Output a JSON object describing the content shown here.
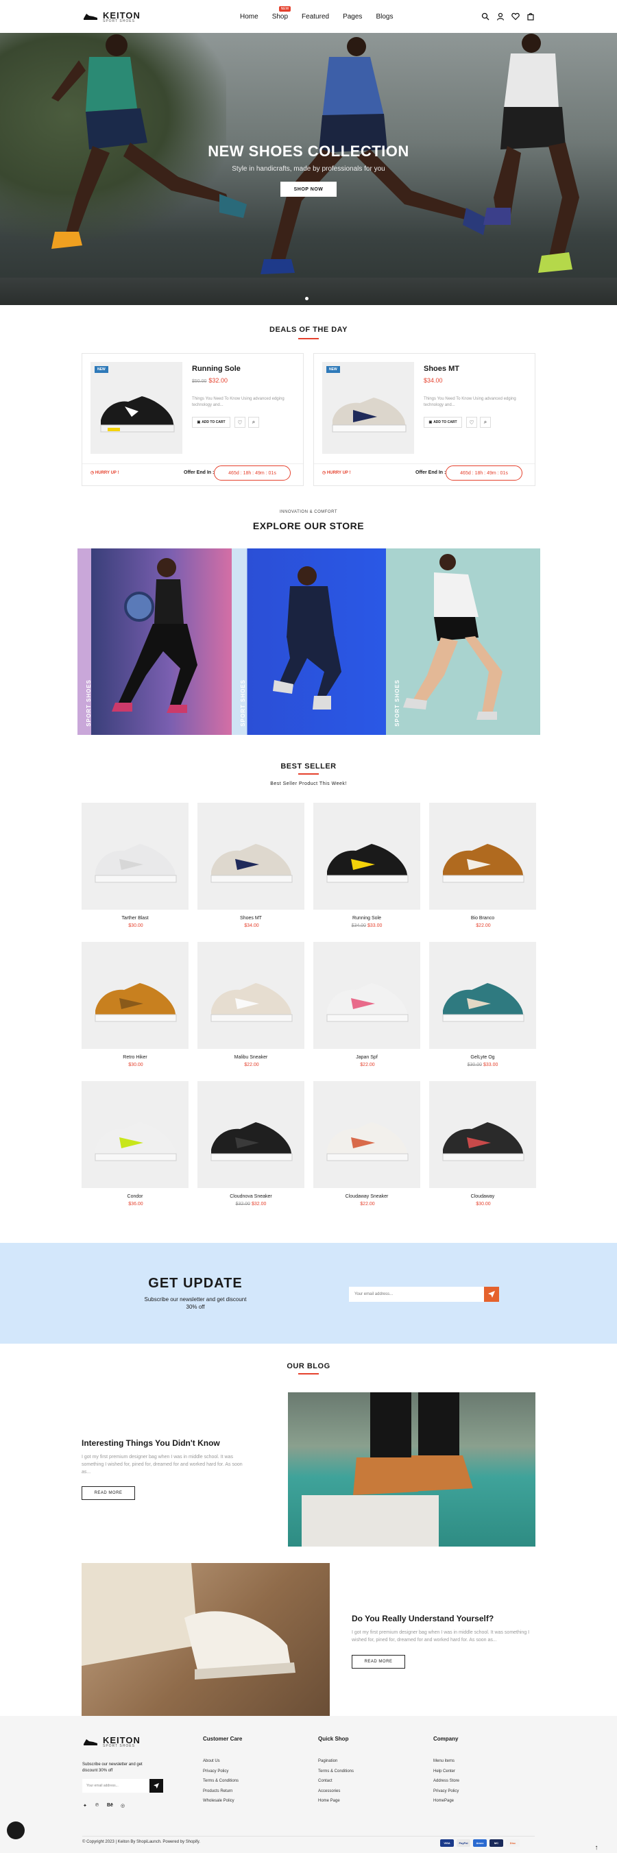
{
  "header": {
    "logo_text": "KEITON",
    "logo_sub": "SPORT SHOES",
    "nav": [
      {
        "label": "Home"
      },
      {
        "label": "Shop",
        "badge": "NEW"
      },
      {
        "label": "Featured"
      },
      {
        "label": "Pages"
      },
      {
        "label": "Blogs"
      }
    ]
  },
  "hero": {
    "title": "NEW SHOES COLLECTION",
    "subtitle": "Style in handicrafts, made by professionals for you",
    "button": "SHOP NOW"
  },
  "deals": {
    "title": "DEALS OF THE DAY",
    "items": [
      {
        "badge": "NEW",
        "name": "Running Sole",
        "old_price": "$50.00",
        "price": "$32.00",
        "desc": "Things You Need To Know Using advanced edging technology and...",
        "cart": "ADD TO CART",
        "hurry": "HURRY UP !",
        "offer": "Offer End In :",
        "timer": "465d : 18h : 49m : 01s"
      },
      {
        "badge": "NEW",
        "name": "Shoes MT",
        "old_price": "",
        "price": "$34.00",
        "desc": "Things You Need To Know Using advanced edging technology and...",
        "cart": "ADD TO CART",
        "hurry": "HURRY UP !",
        "offer": "Offer End In :",
        "timer": "465d : 18h : 49m : 01s"
      }
    ]
  },
  "explore": {
    "kicker": "INNOVATION & COMFORT",
    "title": "EXPLORE OUR STORE",
    "panels": [
      {
        "label": "SPORT SHOES"
      },
      {
        "label": "SPORT SHOES"
      },
      {
        "label": "SPORT SHOES"
      }
    ]
  },
  "bestseller": {
    "title": "BEST SELLER",
    "subtitle": "Best Seller Product This Week!",
    "products": [
      {
        "name": "Tarther Blast",
        "old_price": "",
        "price": "$30.00"
      },
      {
        "name": "Shoes MT",
        "old_price": "",
        "price": "$34.00"
      },
      {
        "name": "Running Sole",
        "old_price": "$34.00",
        "price": "$33.00"
      },
      {
        "name": "Bio Branco",
        "old_price": "",
        "price": "$22.00"
      },
      {
        "name": "Retro Hiker",
        "old_price": "",
        "price": "$30.00"
      },
      {
        "name": "Malibu Sneaker",
        "old_price": "",
        "price": "$22.00"
      },
      {
        "name": "Japan Spf",
        "old_price": "",
        "price": "$22.00"
      },
      {
        "name": "GelLyte Og",
        "old_price": "$30.00",
        "price": "$33.00"
      },
      {
        "name": "Condor",
        "old_price": "",
        "price": "$36.00"
      },
      {
        "name": "Cloudnova Sneaker",
        "old_price": "$32.00",
        "price": "$32.00"
      },
      {
        "name": "Cloudaway Sneaker",
        "old_price": "",
        "price": "$22.00"
      },
      {
        "name": "Cloudaway",
        "old_price": "",
        "price": "$30.00"
      }
    ]
  },
  "newsletter": {
    "title": "GET UPDATE",
    "subtitle": "Subscribe our newsletter and get discount 30% off",
    "placeholder": "Your email address..."
  },
  "blog": {
    "title": "OUR BLOG",
    "posts": [
      {
        "title": "Interesting Things You Didn't Know",
        "excerpt": "I got my first premium designer bag when I was in middle school. It was something I wished for, pined for, dreamed for and worked hard for. As soon as...",
        "button": "READ MORE"
      },
      {
        "title": "Do You Really Understand Yourself?",
        "excerpt": "I got my first premium designer bag when I was in middle school. It was something I wished for, pined for, dreamed for and worked hard for. As soon as...",
        "button": "READ MORE"
      }
    ]
  },
  "footer": {
    "desc": "Subscribe our newsletter and get discount 30% off",
    "placeholder": "Your email address...",
    "cols": [
      {
        "title": "Customer Care",
        "links": [
          "About Us",
          "Privacy Policy",
          "Terms & Conditions",
          "Products Return",
          "Wholesale Policy"
        ]
      },
      {
        "title": "Quick Shop",
        "links": [
          "Pagination",
          "Terms & Conditions",
          "Contact",
          "Accessories",
          "Home Page"
        ]
      },
      {
        "title": "Company",
        "links": [
          "Menu items",
          "Help Center",
          "Address Store",
          "Privacy Policy",
          "HomePage"
        ]
      }
    ],
    "copyright": "© Copyright 2023 | Keiton By ShopiLaunch. Powered by Shopify.",
    "payments": [
      "VISA",
      "PayPal",
      "Amex",
      "MC",
      "Disc"
    ]
  },
  "colors": {
    "accent": "#e5412d",
    "newsletter_bg": "#d3e7fb",
    "badge_blue": "#2f7ab9"
  }
}
